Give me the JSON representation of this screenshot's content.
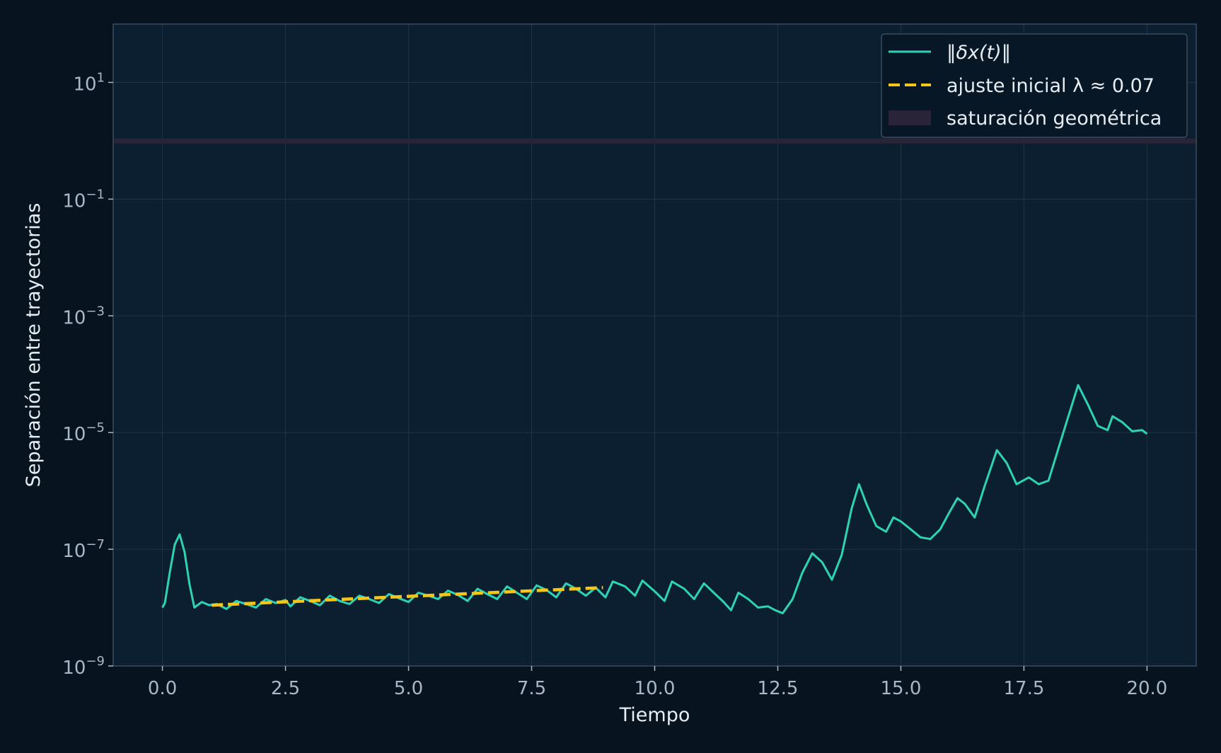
{
  "chart_data": {
    "type": "line",
    "title": "",
    "xlabel": "Tiempo",
    "ylabel": "Separación entre trayectorias",
    "xlim": [
      -1.0,
      21.0
    ],
    "ylim": [
      1e-09,
      100.0
    ],
    "yscale": "log",
    "grid": true,
    "legend_position": "top-right",
    "x_ticks": [
      0.0,
      2.5,
      5.0,
      7.5,
      10.0,
      12.5,
      15.0,
      17.5,
      20.0
    ],
    "x_tick_labels": [
      "0.0",
      "2.5",
      "5.0",
      "7.5",
      "10.0",
      "12.5",
      "15.0",
      "17.5",
      "20.0"
    ],
    "y_ticks": [
      {
        "value": 1e-09,
        "base": "10",
        "exp": "−9"
      },
      {
        "value": 1e-07,
        "base": "10",
        "exp": "−7"
      },
      {
        "value": 1e-05,
        "base": "10",
        "exp": "−5"
      },
      {
        "value": 0.001,
        "base": "10",
        "exp": "−3"
      },
      {
        "value": 0.1,
        "base": "10",
        "exp": "−1"
      },
      {
        "value": 10.0,
        "base": "10",
        "exp": "1"
      }
    ],
    "band": {
      "name": "saturación geométrica",
      "y0": 0.9,
      "y1": 1.1,
      "color": "#2a2438"
    },
    "series": [
      {
        "name": "‖δx(t)‖",
        "color": "#2ed3b7",
        "style": "solid",
        "points": [
          [
            0.0,
            1e-08
          ],
          [
            0.05,
            1.2e-08
          ],
          [
            0.15,
            4e-08
          ],
          [
            0.25,
            1.2e-07
          ],
          [
            0.35,
            1.8e-07
          ],
          [
            0.45,
            9e-08
          ],
          [
            0.55,
            2.5e-08
          ],
          [
            0.65,
            1e-08
          ],
          [
            0.8,
            1.25e-08
          ],
          [
            0.95,
            1.1e-08
          ],
          [
            1.1,
            1.15e-08
          ],
          [
            1.3,
            9.5e-09
          ],
          [
            1.5,
            1.3e-08
          ],
          [
            1.7,
            1.15e-08
          ],
          [
            1.9,
            1e-08
          ],
          [
            2.1,
            1.4e-08
          ],
          [
            2.3,
            1.2e-08
          ],
          [
            2.5,
            1.35e-08
          ],
          [
            2.6,
            1.05e-08
          ],
          [
            2.8,
            1.5e-08
          ],
          [
            3.0,
            1.3e-08
          ],
          [
            3.2,
            1.1e-08
          ],
          [
            3.4,
            1.6e-08
          ],
          [
            3.6,
            1.3e-08
          ],
          [
            3.8,
            1.15e-08
          ],
          [
            4.0,
            1.6e-08
          ],
          [
            4.2,
            1.4e-08
          ],
          [
            4.4,
            1.2e-08
          ],
          [
            4.6,
            1.7e-08
          ],
          [
            4.8,
            1.45e-08
          ],
          [
            5.0,
            1.25e-08
          ],
          [
            5.2,
            1.8e-08
          ],
          [
            5.4,
            1.6e-08
          ],
          [
            5.6,
            1.4e-08
          ],
          [
            5.8,
            1.95e-08
          ],
          [
            6.0,
            1.65e-08
          ],
          [
            6.2,
            1.3e-08
          ],
          [
            6.4,
            2.1e-08
          ],
          [
            6.6,
            1.7e-08
          ],
          [
            6.8,
            1.4e-08
          ],
          [
            7.0,
            2.3e-08
          ],
          [
            7.2,
            1.8e-08
          ],
          [
            7.4,
            1.4e-08
          ],
          [
            7.6,
            2.4e-08
          ],
          [
            7.8,
            2e-08
          ],
          [
            8.0,
            1.5e-08
          ],
          [
            8.2,
            2.6e-08
          ],
          [
            8.4,
            2.1e-08
          ],
          [
            8.6,
            1.6e-08
          ],
          [
            8.8,
            2.2e-08
          ],
          [
            9.0,
            1.5e-08
          ],
          [
            9.15,
            2.8e-08
          ],
          [
            9.4,
            2.3e-08
          ],
          [
            9.6,
            1.6e-08
          ],
          [
            9.75,
            2.9e-08
          ],
          [
            10.0,
            1.9e-08
          ],
          [
            10.2,
            1.3e-08
          ],
          [
            10.35,
            2.8e-08
          ],
          [
            10.6,
            2.1e-08
          ],
          [
            10.8,
            1.4e-08
          ],
          [
            11.0,
            2.6e-08
          ],
          [
            11.2,
            1.8e-08
          ],
          [
            11.4,
            1.25e-08
          ],
          [
            11.55,
            9e-09
          ],
          [
            11.7,
            1.8e-08
          ],
          [
            11.9,
            1.4e-08
          ],
          [
            12.1,
            1e-08
          ],
          [
            12.3,
            1.05e-08
          ],
          [
            12.45,
            9e-09
          ],
          [
            12.6,
            8e-09
          ],
          [
            12.8,
            1.4e-08
          ],
          [
            13.0,
            4e-08
          ],
          [
            13.2,
            8.5e-08
          ],
          [
            13.4,
            6e-08
          ],
          [
            13.6,
            3e-08
          ],
          [
            13.8,
            8e-08
          ],
          [
            14.0,
            5e-07
          ],
          [
            14.15,
            1.3e-06
          ],
          [
            14.3,
            6e-07
          ],
          [
            14.5,
            2.5e-07
          ],
          [
            14.7,
            2e-07
          ],
          [
            14.85,
            3.5e-07
          ],
          [
            15.0,
            3e-07
          ],
          [
            15.2,
            2.2e-07
          ],
          [
            15.4,
            1.6e-07
          ],
          [
            15.6,
            1.5e-07
          ],
          [
            15.8,
            2.2e-07
          ],
          [
            16.0,
            4.5e-07
          ],
          [
            16.15,
            7.5e-07
          ],
          [
            16.3,
            6e-07
          ],
          [
            16.5,
            3.5e-07
          ],
          [
            16.7,
            1.2e-06
          ],
          [
            16.95,
            5e-06
          ],
          [
            17.15,
            3e-06
          ],
          [
            17.35,
            1.3e-06
          ],
          [
            17.6,
            1.7e-06
          ],
          [
            17.8,
            1.3e-06
          ],
          [
            18.0,
            1.5e-06
          ],
          [
            18.3,
            1e-05
          ],
          [
            18.6,
            6.5e-05
          ],
          [
            18.8,
            3e-05
          ],
          [
            19.0,
            1.3e-05
          ],
          [
            19.2,
            1.1e-05
          ],
          [
            19.3,
            1.9e-05
          ],
          [
            19.5,
            1.5e-05
          ],
          [
            19.7,
            1.05e-05
          ],
          [
            19.9,
            1.1e-05
          ],
          [
            20.0,
            9.5e-06
          ]
        ]
      },
      {
        "name": "ajuste inicial λ ≈ 0.07",
        "color": "#f5c518",
        "style": "dashed",
        "points": [
          [
            1.0,
            1.1e-08
          ],
          [
            8.95,
            2.2e-08
          ]
        ]
      }
    ]
  },
  "legend": {
    "line_label": "‖δx(t)‖",
    "fit_label": "ajuste inicial λ ≈ 0.07",
    "band_label": "saturación geométrica"
  },
  "colors": {
    "background": "#07131f",
    "plot_area": "#0c1f30",
    "grid": "#1f3447",
    "axis_text": "#a9b8c8",
    "label_text": "#e6edf3"
  }
}
